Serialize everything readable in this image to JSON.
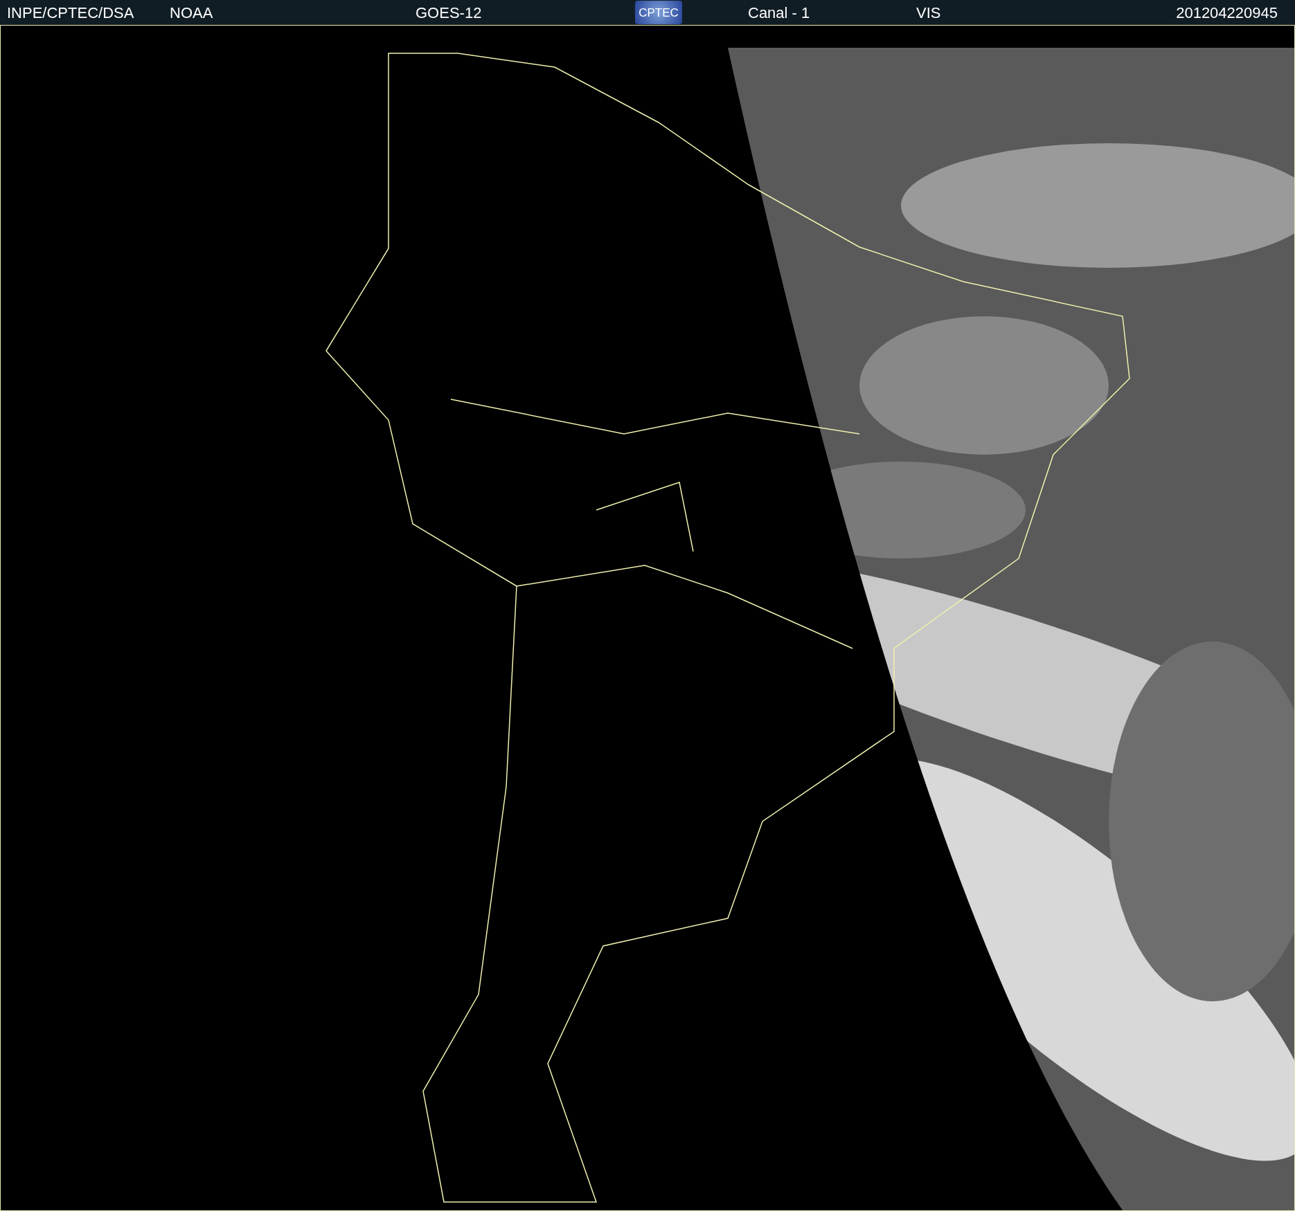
{
  "header": {
    "source": "INPE/CPTEC/DSA",
    "agency": "NOAA",
    "satellite": "GOES-12",
    "logo": "CPTEC",
    "channel": "Canal - 1",
    "band": "VIS",
    "timestamp": "201204220945"
  }
}
